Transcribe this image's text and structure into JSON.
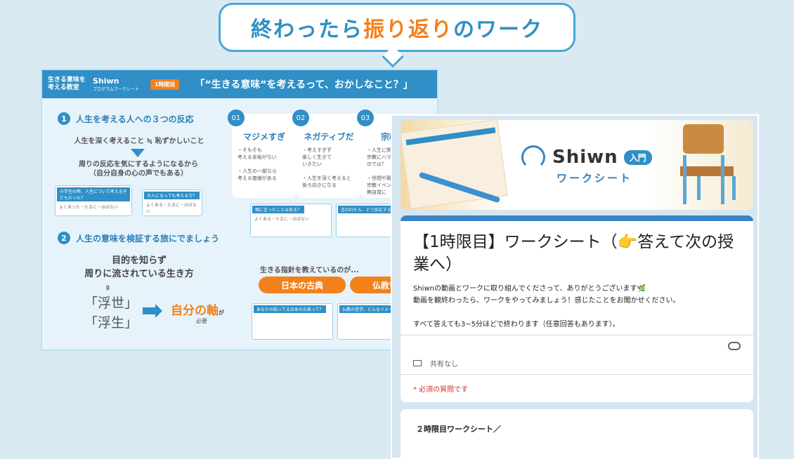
{
  "bubble": {
    "part1": "終わったら",
    "part2": "振り返り",
    "part3": "のワーク"
  },
  "sheet": {
    "header": {
      "left": "生きる意味を考える教室",
      "logo": "Shiwn",
      "logo_sub": "プログラムワークシート",
      "badge": "1時間目",
      "title": "「“生きる意味“を考えるって、おかしなこと？」"
    },
    "section1": {
      "num": "1",
      "title": "人生を考える人への３つの反応"
    },
    "eq": "人生を深く考えること ≒ 恥ずかしいこと",
    "reaction": "周りの反応を気にするようになるから\n（自分自身の心の声でもある）",
    "notes": [
      {
        "tag": "小学生の時、人生について考える子どもだった？",
        "body": "よくあった・たまに・ほぼない"
      },
      {
        "tag": "大人になっても考える方？",
        "body": "よくある・たまに・ほぼない"
      },
      {
        "tag": "親に言ったことはある？",
        "body": "よくある・たまに・ほぼない"
      },
      {
        "tag": "言われたら、どう反応する？",
        "body": ""
      },
      {
        "tag": "あなたの知ってる日本の古典って？",
        "body": ""
      },
      {
        "tag": "仏教の哲学、どんなイメージ？",
        "body": ""
      }
    ],
    "cards": [
      {
        "num": "01",
        "title": "マジメすぎ",
        "body": "・そもそも\n考える余裕がない\n\n・人生の一部なら\n考える価値がある"
      },
      {
        "num": "02",
        "title": "ネガティブだ",
        "body": "・考えすぎず\n楽しく生きて\nいきたい\n\n・人生を深く考えると\n後ろ向きになる"
      },
      {
        "num": "03",
        "title": "宗教て",
        "body": "・人生に関し\n宗教にハマ\nのでは？\n\n・世間や親\n宗教イベン\n無自覚に"
      }
    ],
    "section2": {
      "num": "2",
      "title": "人生の意味を検証する旅にでましょう"
    },
    "goal": "目的を知らず\n周りに流されている生き方",
    "equals": "॥",
    "kanji": "「浮世」\n「浮生」",
    "axis": "自分の軸",
    "axis_ga": "が",
    "needed": "必要",
    "guide": "生きる指針を教えているのが...",
    "pills": [
      "日本の古典",
      "仏教哲"
    ]
  },
  "form": {
    "banner_logo": "Shiwn",
    "banner_tag": "入門",
    "banner_sub": "ワークシート",
    "title": "【1時限目】ワークシート（👉答えて次の授業へ）",
    "description": "Shiwnの動画とワークに取り組んでくださって、ありがとうございます🌿\n動画を観終わったら、ワークをやってみましょう！感じたことをお聞かせください。\n\nすべて答えても3~5分ほどで終わります（任意回答もあります）。",
    "share": "共有なし",
    "required": "* 必須の質問です",
    "next_section": "２時限目ワークシート／"
  }
}
